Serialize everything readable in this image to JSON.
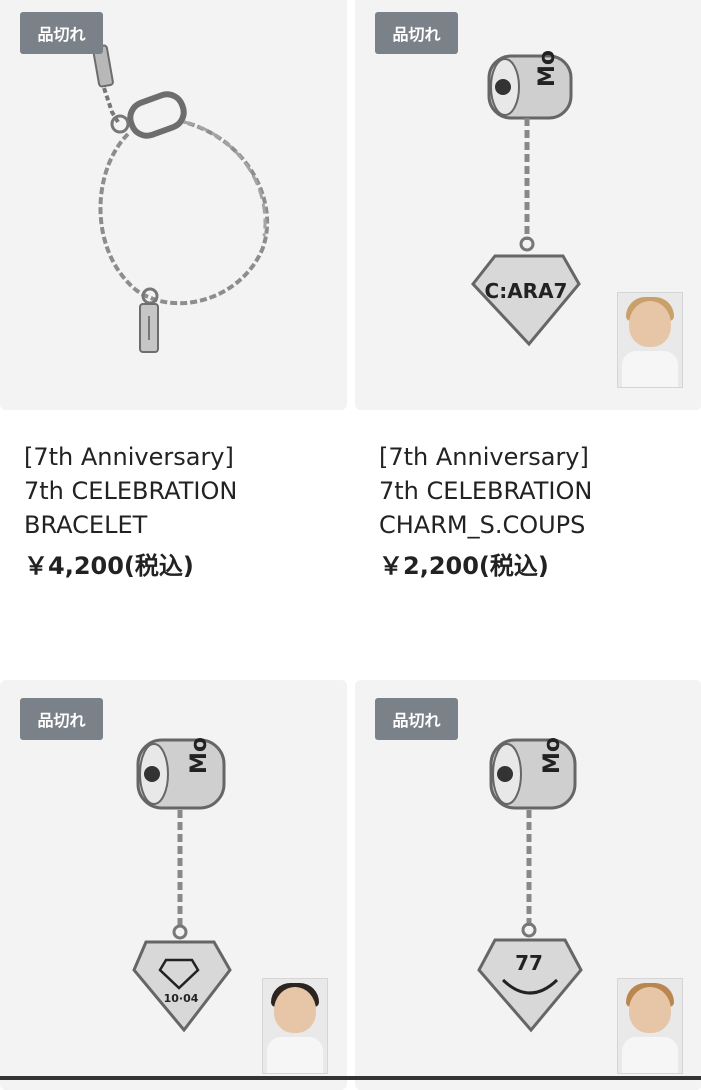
{
  "products": [
    {
      "badge": "品切れ",
      "name_line1": "[7th Anniversary]",
      "name_line2": "7th CELEBRATION",
      "name_line3": "BRACELET",
      "price": "￥4,200(税込)",
      "image_icon": "bracelet-image"
    },
    {
      "badge": "品切れ",
      "name_line1": "[7th Anniversary]",
      "name_line2": "7th CELEBRATION",
      "name_line3": "CHARM_S.COUPS",
      "price": "￥2,200(税込)",
      "image_icon": "charm-image",
      "charm_text": "C:ARA7",
      "bead_text": "Mo",
      "photocard_icon": "photocard-image"
    },
    {
      "badge": "品切れ",
      "image_icon": "charm-image",
      "bead_text": "Mo",
      "charm_text": "10·04",
      "photocard_icon": "photocard-image"
    },
    {
      "badge": "品切れ",
      "image_icon": "charm-image",
      "bead_text": "Mo",
      "charm_text": "77",
      "photocard_icon": "photocard-image"
    }
  ],
  "colors": {
    "card_bg": "#f3f3f3",
    "badge_bg": "#7a8188",
    "text": "#222222"
  }
}
